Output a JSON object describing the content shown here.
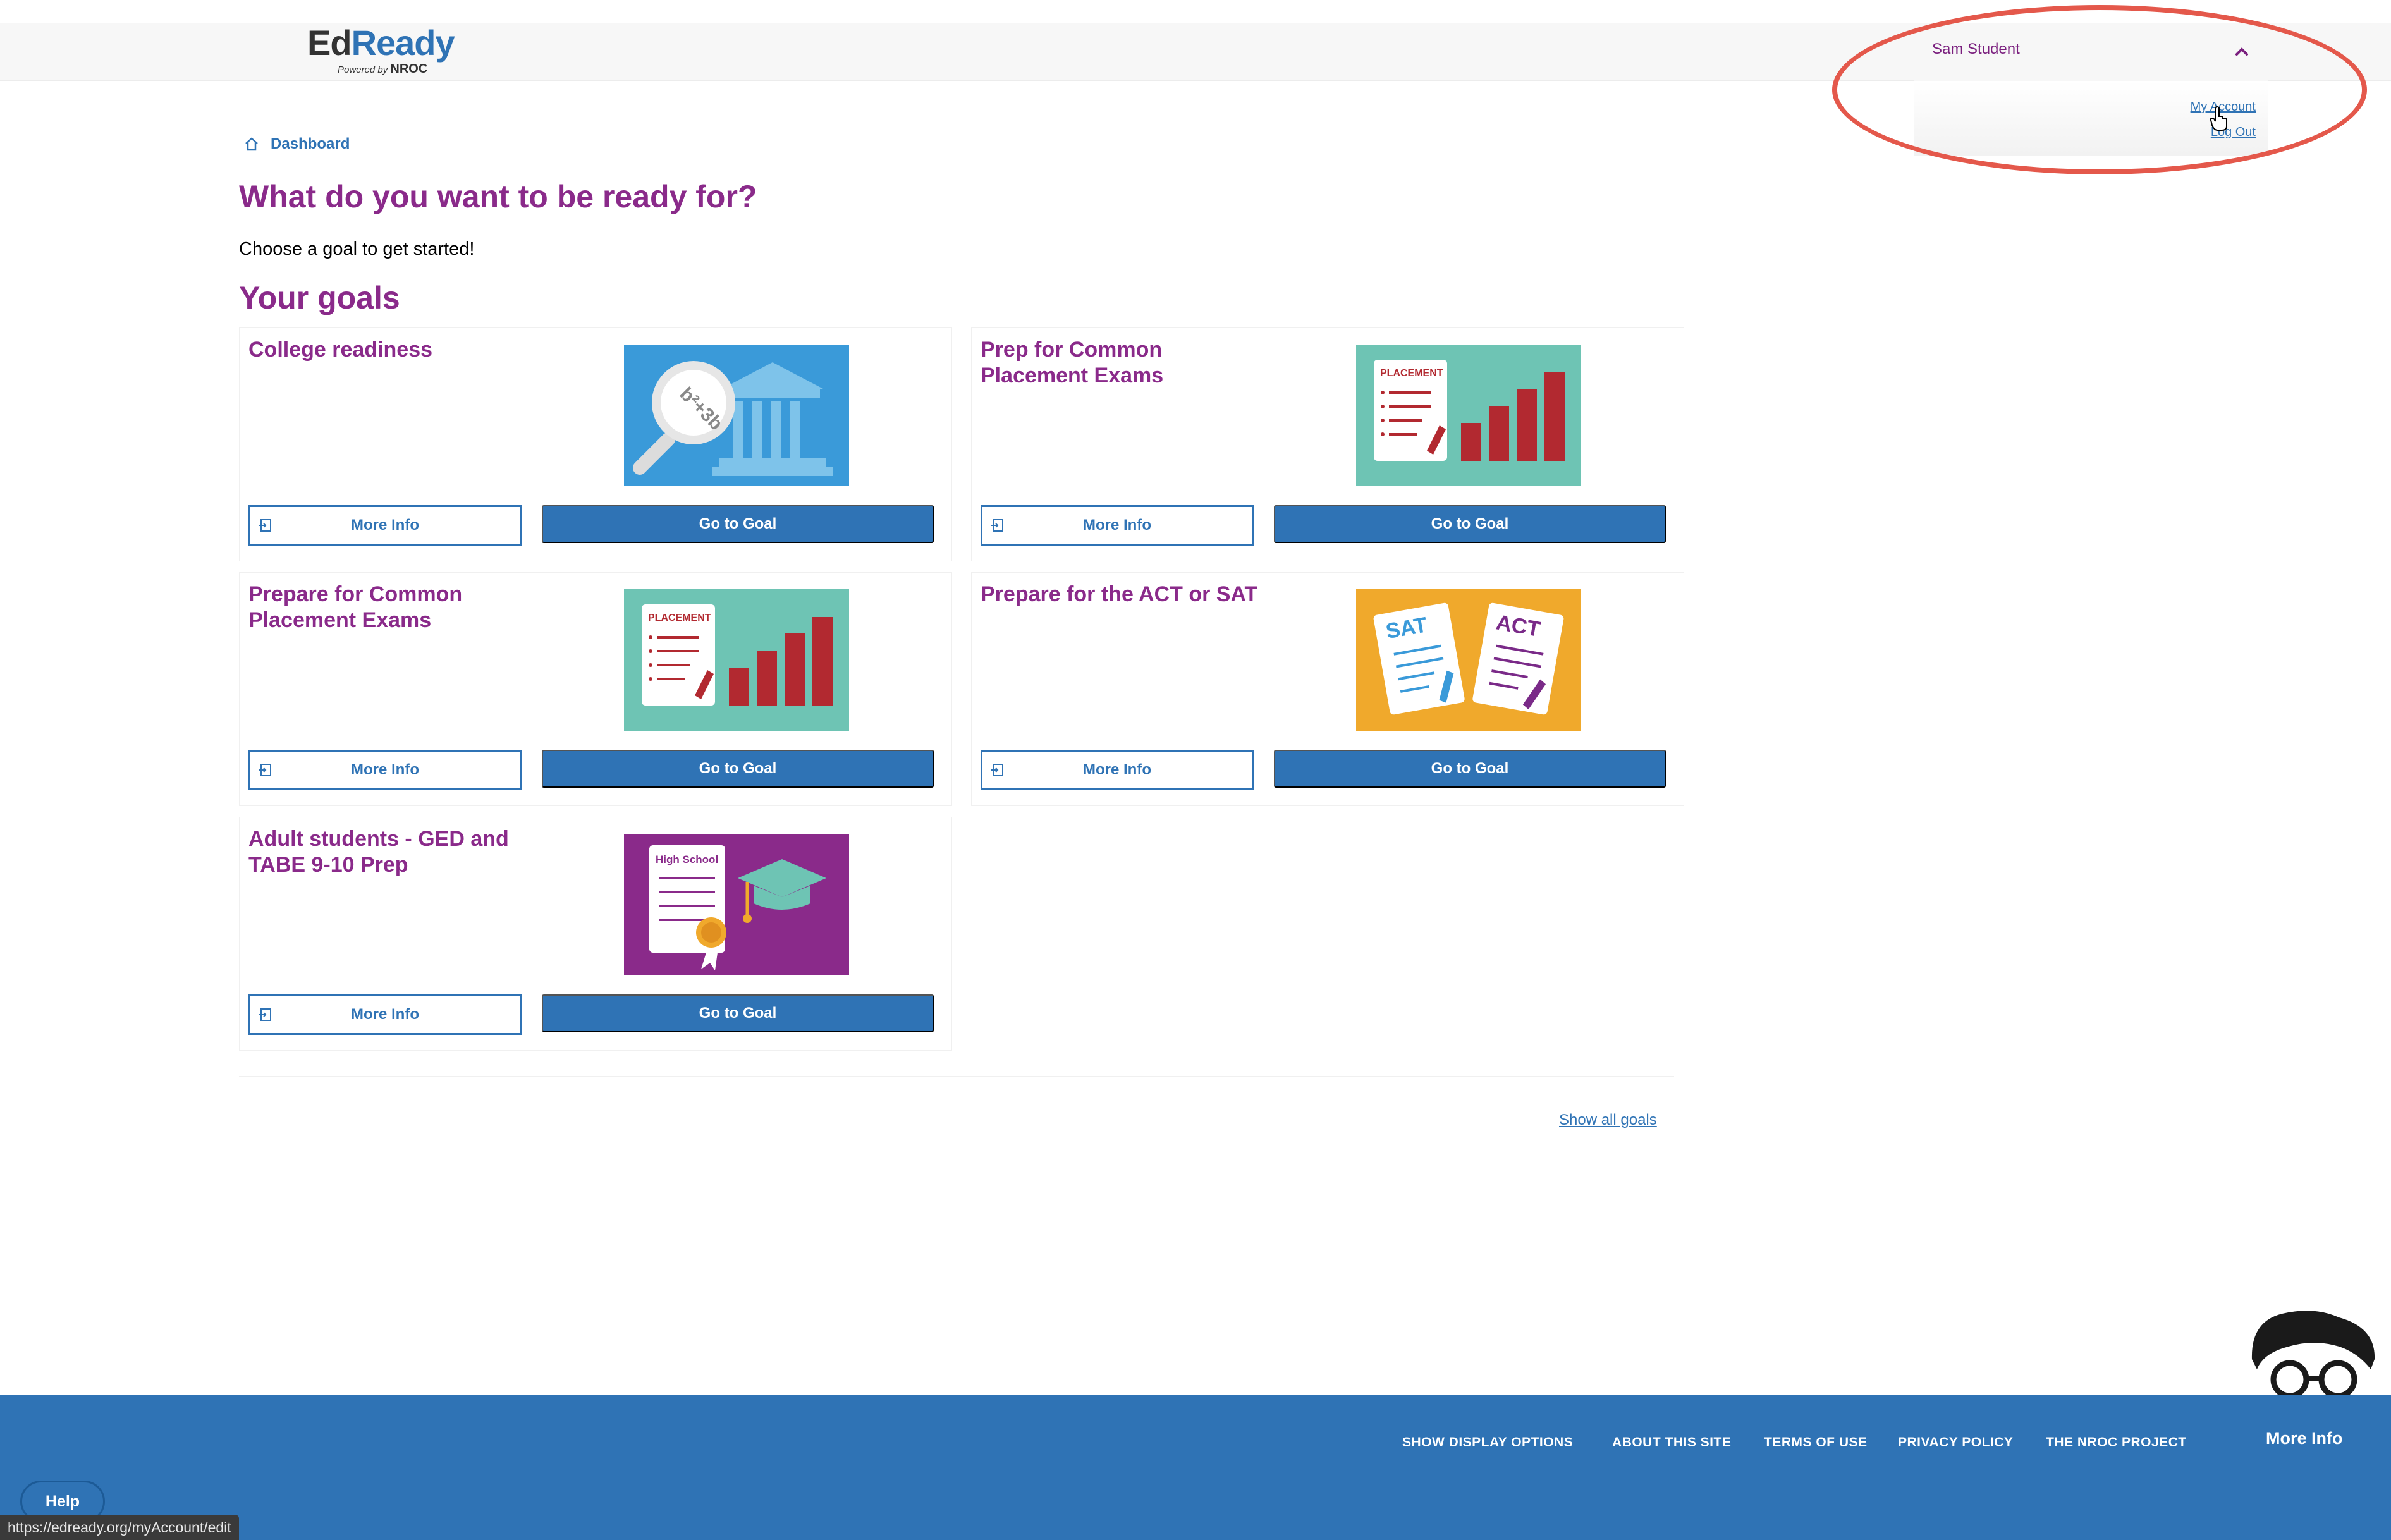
{
  "header": {
    "logo_ed": "Ed",
    "logo_ready": "Ready",
    "logo_powered": "Powered by",
    "logo_nroc": "NROC"
  },
  "user_menu": {
    "name": "Sam Student",
    "my_account": "My Account",
    "log_out": "Log Out"
  },
  "breadcrumb": {
    "label": "Dashboard"
  },
  "page_title": "What do you want to be ready for?",
  "intro": "Choose a goal to get started!",
  "goals_title": "Your goals",
  "goals": [
    {
      "title": "College readiness",
      "more_info": "More Info",
      "go_to_goal": "Go to Goal",
      "image": "magnifier-building"
    },
    {
      "title": "Prep for Common Placement Exams",
      "more_info": "More Info",
      "go_to_goal": "Go to Goal",
      "image": "placement-chart",
      "image_label": "PLACEMENT"
    },
    {
      "title": "Prepare for Common Placement Exams",
      "more_info": "More Info",
      "go_to_goal": "Go to Goal",
      "image": "placement-chart",
      "image_label": "PLACEMENT"
    },
    {
      "title": "Prepare for the ACT or SAT",
      "more_info": "More Info",
      "go_to_goal": "Go to Goal",
      "image": "sat-act",
      "image_label_1": "SAT",
      "image_label_2": "ACT"
    },
    {
      "title": "Adult students - GED and TABE 9-10 Prep",
      "more_info": "More Info",
      "go_to_goal": "Go to Goal",
      "image": "diploma-cap",
      "image_label": "High School"
    }
  ],
  "show_all_goals": "Show all goals",
  "footer": {
    "links": [
      "SHOW DISPLAY OPTIONS",
      "ABOUT THIS SITE",
      "TERMS OF USE",
      "PRIVACY POLICY",
      "THE NROC PROJECT"
    ],
    "more_info": "More Info"
  },
  "help": "Help",
  "status_url": "https://edready.org/myAccount/edit",
  "colors": {
    "brand_blue": "#2f73b5",
    "heading_purple": "#8a2a8a",
    "highlight_red": "#e4584b"
  }
}
